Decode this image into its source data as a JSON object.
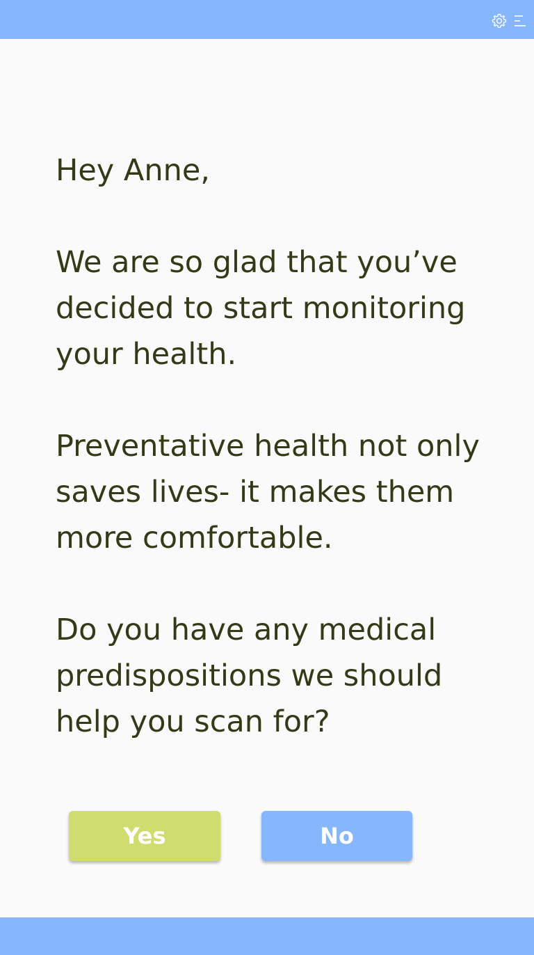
{
  "header": {
    "icons": [
      "gear-icon",
      "menu-icon"
    ],
    "background": "#86b6fc"
  },
  "message": {
    "greeting": "Hey Anne,",
    "paragraph_1": "We are so glad that you’ve decided to start monitoring your health.",
    "paragraph_2": "Preventative health not only saves lives- it makes them more comfortable.",
    "question": "Do you have any medical predispositions we should help you scan for?"
  },
  "actions": {
    "yes_label": "Yes",
    "no_label": "No",
    "yes_color": "#cfdd6e",
    "no_color": "#86b6fc"
  },
  "colors": {
    "text": "#323a17",
    "background": "#fafafa",
    "bar": "#86b6fc"
  }
}
